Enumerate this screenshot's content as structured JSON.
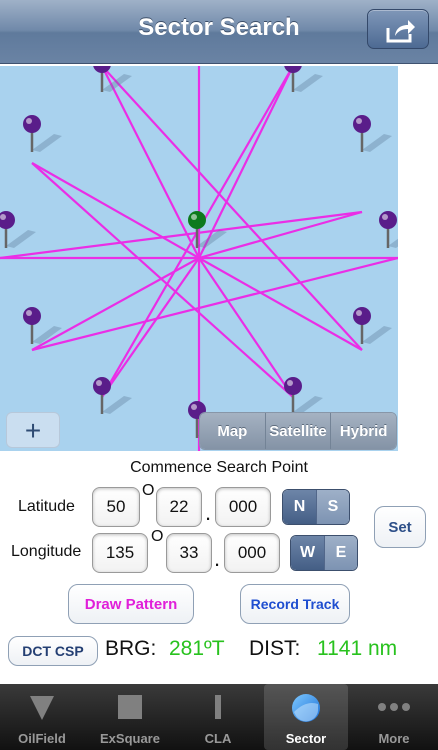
{
  "nav": {
    "title": "Sector Search"
  },
  "map": {
    "map_type_options": [
      "Map",
      "Satellite",
      "Hybrid"
    ],
    "locate_label": "+",
    "pattern_color": "#ea2ee6",
    "pin_color": "#5a1d8a",
    "center_pin_color": "#0d7a1c",
    "water_color": "#a9d2ee"
  },
  "form": {
    "commence_label": "Commence Search Point",
    "latitude_label": "Latitude",
    "longitude_label": "Longitude",
    "lat_deg": "50",
    "lat_min": "22",
    "lat_dec": "000",
    "lon_deg": "135",
    "lon_min": "33",
    "lon_dec": "000",
    "degree_symbol": "O",
    "decimal_dot": ".",
    "ns": [
      "N",
      "S"
    ],
    "ns_selected": "N",
    "ew": [
      "W",
      "E"
    ],
    "ew_selected": "W",
    "set_label": "Set",
    "draw_pattern_label": "Draw Pattern",
    "record_track_label": "Record Track",
    "dct_csp_label": "DCT CSP",
    "brg_label": "BRG:",
    "brg_value": "281ºT",
    "dist_label": "DIST:",
    "dist_value": "1141 nm",
    "value_color": "#28c21e"
  },
  "tabs": [
    {
      "label": "OilField",
      "icon": "triangle-icon",
      "active": false
    },
    {
      "label": "ExSquare",
      "icon": "square-icon",
      "active": false
    },
    {
      "label": "CLA",
      "icon": "bar-icon",
      "active": false
    },
    {
      "label": "Sector",
      "icon": "circle-icon",
      "active": true
    },
    {
      "label": "More",
      "icon": "more-dots-icon",
      "active": false
    }
  ]
}
